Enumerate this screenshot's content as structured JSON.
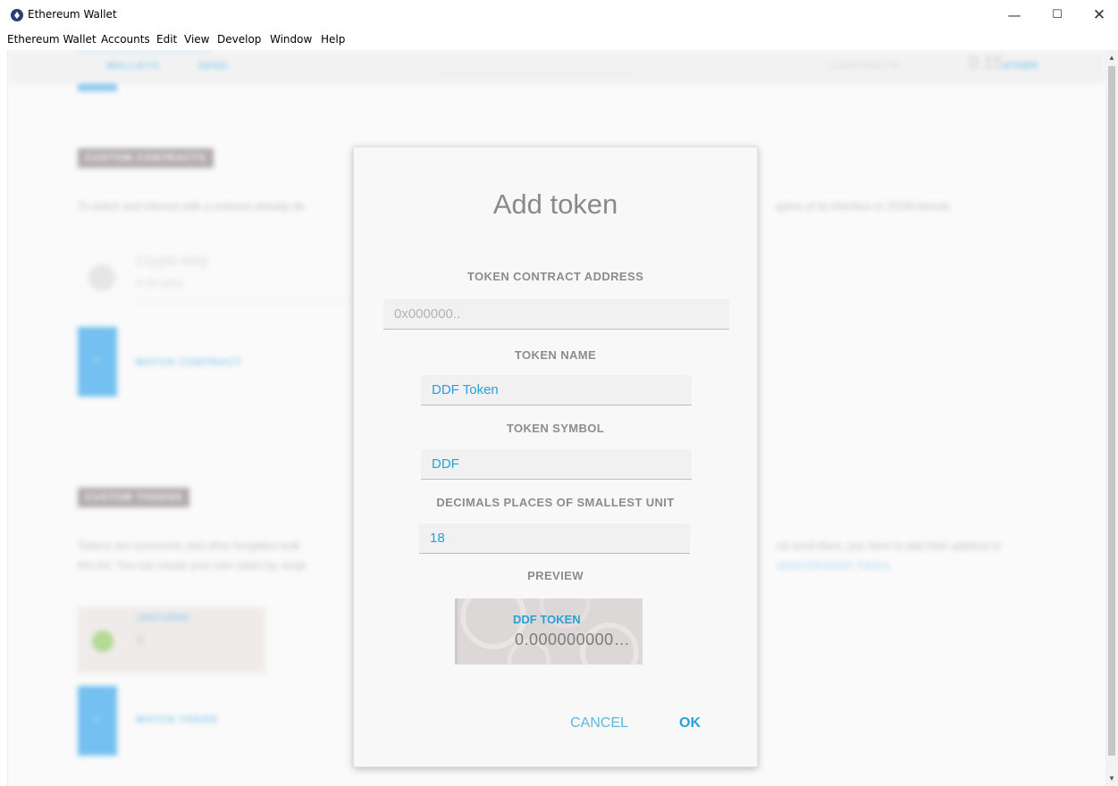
{
  "window": {
    "title": "Ethereum Wallet",
    "controls": {
      "minimize": "—",
      "maximize": "☐",
      "close": "✕"
    }
  },
  "menu": [
    "Ethereum Wallet",
    "Accounts",
    "Edit",
    "View",
    "Develop",
    "Window",
    "Help"
  ],
  "background": {
    "nav": {
      "wallets": "WALLETS",
      "send": "SEND",
      "contracts": "CONTRACTS",
      "balance": "0.15",
      "unit": "ETHER"
    },
    "custom_contracts_heading": "CUSTOM CONTRACTS",
    "custom_contracts_text_left": "To watch and interact with a contract already de",
    "custom_contracts_text_right": "iption of its interface in JSON format.",
    "contract_card": {
      "name": "Crypto-kitty",
      "balance": "0.00 ether"
    },
    "watch_contract": "WATCH CONTRACT",
    "custom_tokens_heading": "CUSTOM TOKENS",
    "custom_tokens_text_1_left": "Tokens are currencies and other fungibles built",
    "custom_tokens_text_1_right": "nd send them, you have to add their address to",
    "custom_tokens_text_2_left": "this list. You can create your own token by simpl",
    "custom_tokens_text_2_right": "about Ethereum Tokens.",
    "token_card": {
      "name": "UNICORNS",
      "balance": "0"
    },
    "watch_token": "WATCH TOKEN",
    "plus": "+"
  },
  "modal": {
    "title": "Add token",
    "address_label": "TOKEN CONTRACT ADDRESS",
    "address_placeholder": "0x000000..",
    "name_label": "TOKEN NAME",
    "name_value": "DDF Token",
    "symbol_label": "TOKEN SYMBOL",
    "symbol_value": "DDF",
    "decimals_label": "DECIMALS PLACES OF SMALLEST UNIT",
    "decimals_value": "18",
    "preview_label": "PREVIEW",
    "preview": {
      "name": "DDF TOKEN",
      "balance": "0.000000000…"
    },
    "cancel": "CANCEL",
    "ok": "OK"
  },
  "colors": {
    "accent": "#2a9fd8",
    "heading_bg": "#8a7e7e",
    "button_blue": "#2a9fe8"
  }
}
